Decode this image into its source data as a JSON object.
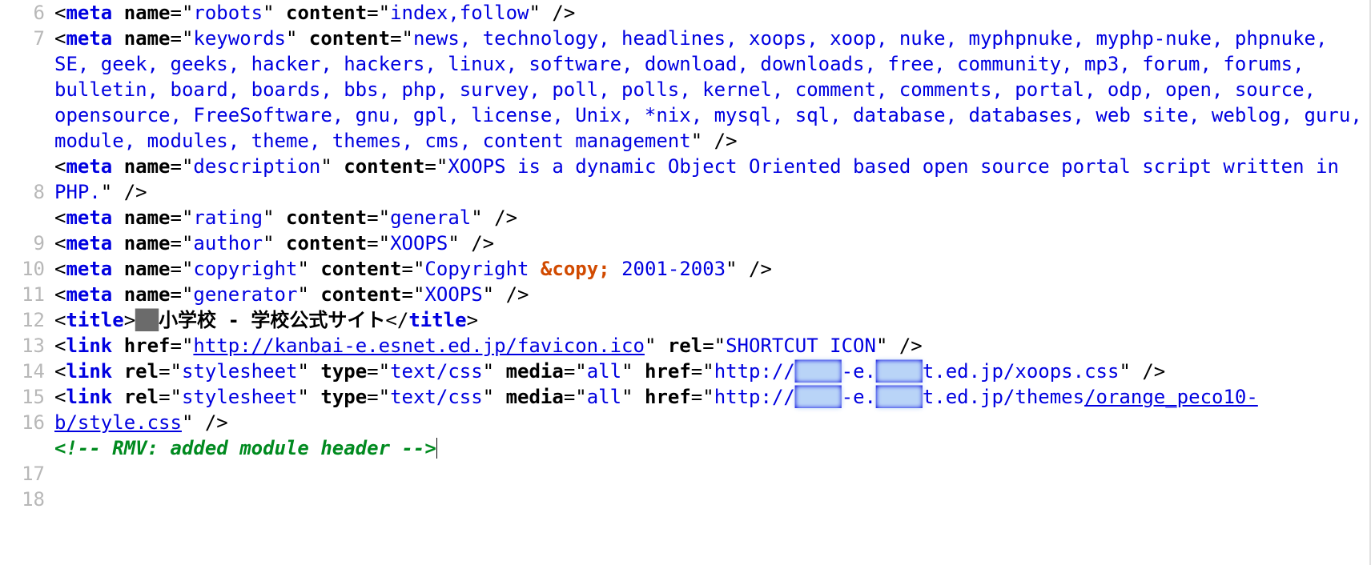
{
  "gutter": [
    "6",
    "7",
    "",
    "",
    "",
    "",
    "",
    "8",
    "",
    "9",
    "10",
    "11",
    "12",
    "13",
    "14",
    "15",
    "16",
    "",
    "17",
    "18"
  ],
  "l6": {
    "name_attr": "name",
    "name_val": "robots",
    "content_attr": "content",
    "content_val": "index,follow"
  },
  "l7": {
    "name_attr": "name",
    "name_val": "keywords",
    "content_attr": "content",
    "content_val": "news, technology, headlines, xoops, xoop, nuke, myphpnuke, myphp-nuke, phpnuke, SE, geek, geeks, hacker, hackers, linux, software, download, downloads, free, community, mp3, forum, forums, bulletin, board, boards, bbs, php, survey, poll, polls, kernel, comment, comments, portal, odp, open, source, opensource, FreeSoftware, gnu, gpl, license, Unix, *nix, mysql, sql, database, databases, web site, weblog, guru, module, modules, theme, themes, cms, content management"
  },
  "l8": {
    "name_attr": "name",
    "name_val": "description",
    "content_attr": "content",
    "content_val": "XOOPS is a dynamic Object Oriented based open source portal script written in PHP."
  },
  "l9": {
    "name_attr": "name",
    "name_val": "rating",
    "content_attr": "content",
    "content_val": "general"
  },
  "l10": {
    "name_attr": "name",
    "name_val": "author",
    "content_attr": "content",
    "content_val": "XOOPS"
  },
  "l11": {
    "name_attr": "name",
    "name_val": "copyright",
    "content_attr": "content",
    "pre": "Copyright ",
    "entity": "&copy;",
    "post": " 2001-2003"
  },
  "l12": {
    "name_attr": "name",
    "name_val": "generator",
    "content_attr": "content",
    "content_val": "XOOPS"
  },
  "l13": {
    "text_pre": "██",
    "text_mid": "小学校 - 学校公式サイト"
  },
  "l14": {
    "href_attr": "href",
    "href_val": "http://kanbai-e.esnet.ed.jp/favicon.ico",
    "rel_attr": "rel",
    "rel_val": "SHORTCUT ICON"
  },
  "l15": {
    "rel_attr": "rel",
    "rel_val": "stylesheet",
    "type_attr": "type",
    "type_val": "text/css",
    "media_attr": "media",
    "media_val": "all",
    "href_attr": "href",
    "href_pre": "http://",
    "href_h1": "████",
    "href_mid": "-e.",
    "href_h2": "████",
    "href_post": "t.ed.jp/xoops.css"
  },
  "l16": {
    "rel_attr": "rel",
    "rel_val": "stylesheet",
    "type_attr": "type",
    "type_val": "text/css",
    "media_attr": "media",
    "media_val": "all",
    "href_attr": "href",
    "href_pre": "http://",
    "href_h1": "████",
    "href_mid": "-e.",
    "href_h2": "████",
    "href_post": "t.ed.jp/themes",
    "href_line2": "/orange_peco10-b/style.css"
  },
  "l17": {
    "comment": "<!-- RMV: added module header -->"
  },
  "tags": {
    "meta": "meta",
    "title": "title",
    "link": "link"
  }
}
